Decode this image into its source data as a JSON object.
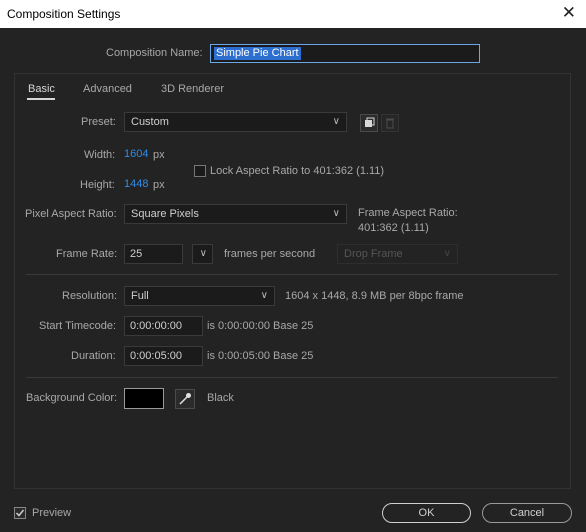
{
  "window": {
    "title": "Composition Settings",
    "close_glyph": "✕"
  },
  "composition_name": {
    "label": "Composition Name:",
    "value": "Simple Pie Chart"
  },
  "tabs": [
    {
      "label": "Basic",
      "active": true
    },
    {
      "label": "Advanced",
      "active": false
    },
    {
      "label": "3D Renderer",
      "active": false
    }
  ],
  "preset": {
    "label": "Preset:",
    "value": "Custom"
  },
  "width": {
    "label": "Width:",
    "value": "1604",
    "unit": "px"
  },
  "height": {
    "label": "Height:",
    "value": "1448",
    "unit": "px"
  },
  "lock_aspect": {
    "label": "Lock Aspect Ratio to 401:362 (1.11)",
    "checked": false
  },
  "pixel_aspect": {
    "label": "Pixel Aspect Ratio:",
    "value": "Square Pixels"
  },
  "frame_aspect": {
    "label": "Frame Aspect Ratio:",
    "value": "401:362 (1.11)"
  },
  "frame_rate": {
    "label": "Frame Rate:",
    "value": "25",
    "unit": "frames per second",
    "drop_frame": "Drop Frame"
  },
  "resolution": {
    "label": "Resolution:",
    "value": "Full",
    "info": "1604 x 1448, 8.9 MB per 8bpc frame"
  },
  "start_timecode": {
    "label": "Start Timecode:",
    "value": "0:00:00:00",
    "info": "is 0:00:00:00  Base 25"
  },
  "duration": {
    "label": "Duration:",
    "value": "0:00:05:00",
    "info": "is 0:00:05:00  Base 25"
  },
  "background": {
    "label": "Background Color:",
    "color": "#000000",
    "name": "Black"
  },
  "footer": {
    "preview_label": "Preview",
    "preview_checked": true,
    "ok_label": "OK",
    "cancel_label": "Cancel"
  },
  "icons": {
    "close": "close-icon",
    "chevron": "chevron-down-icon",
    "new_preset": "save-preset-icon",
    "delete_preset": "trash-icon",
    "eyedropper": "eyedropper-icon",
    "check": "check-icon"
  },
  "colors": {
    "accent": "#2d8ceb",
    "selection": "#2d6fd0",
    "background": "#232323"
  }
}
